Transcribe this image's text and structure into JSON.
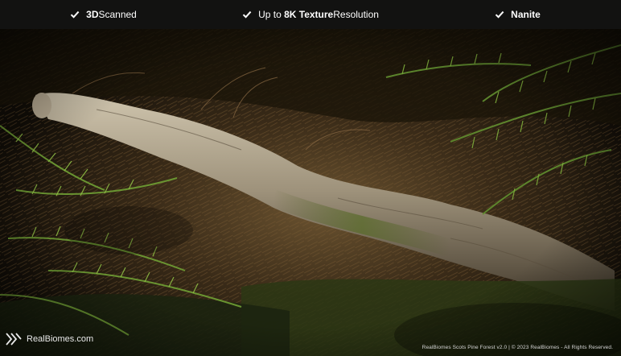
{
  "features": [
    {
      "prefix": "",
      "bold": "3D",
      "suffix": " Scanned"
    },
    {
      "prefix": "Up to ",
      "bold": "8K Texture",
      "suffix": " Resolution"
    },
    {
      "prefix": "",
      "bold": "Nanite",
      "suffix": ""
    }
  ],
  "footer": {
    "brand": "RealBiomes.com",
    "copyright": "RealBiomes Scots Pine Forest v2.0 | © 2023 RealBiomes - All Rights Reserved."
  },
  "icons": {
    "feature_check": "checkmark-icon",
    "brand_logo": "realbiomes-logo-icon"
  },
  "colors": {
    "topbar": "#121211",
    "text": "#ffffff",
    "fern": "#5f8a2e",
    "log": "#a89c86",
    "ground": "#2b2214"
  }
}
